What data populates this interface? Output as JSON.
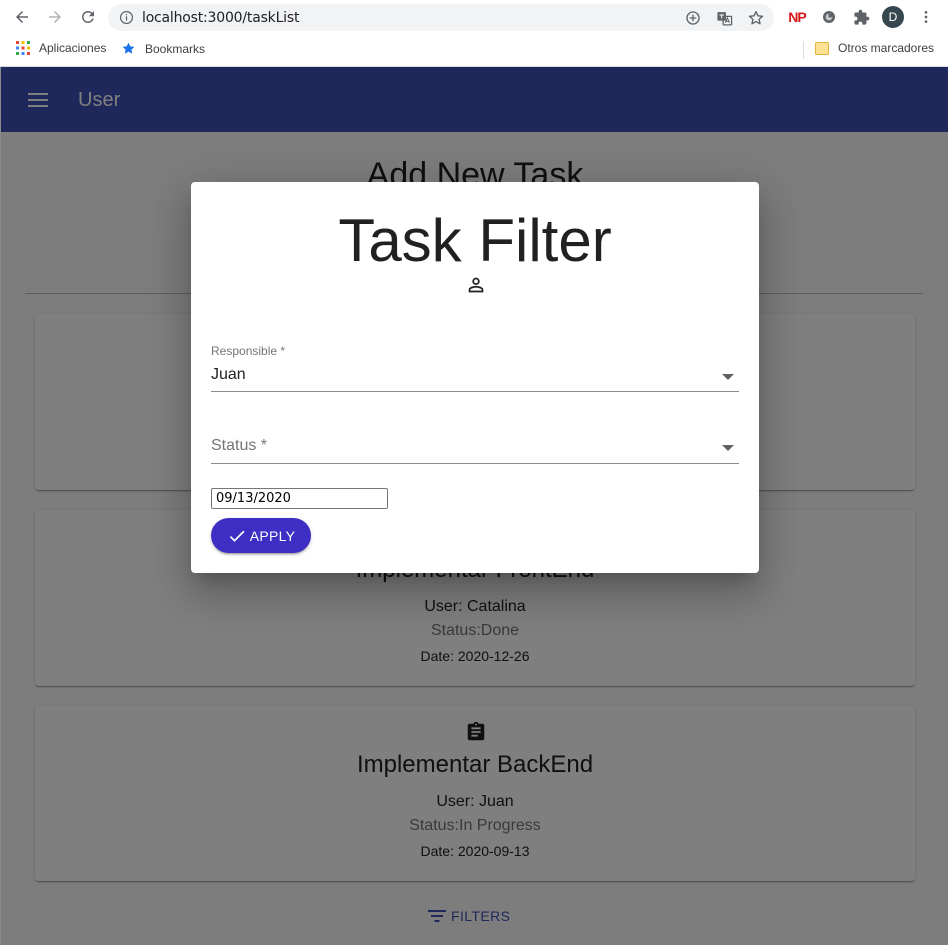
{
  "browser": {
    "url": "localhost:3000/taskList",
    "bookmarks": [
      {
        "label": "Aplicaciones"
      },
      {
        "label": "Bookmarks"
      }
    ],
    "other_bookmarks": "Otros marcadores",
    "extension_np": "NP",
    "avatar_letter": "D"
  },
  "appbar": {
    "title": "User"
  },
  "page": {
    "heading": "Add New Task",
    "filters_label": "FILTERS"
  },
  "cards": [
    {
      "title": "",
      "user": "",
      "status": "",
      "date": ""
    },
    {
      "title": "Implementar FrontEnd",
      "user": "User: Catalina",
      "status": "Status:Done",
      "date": "Date: 2020-12-26"
    },
    {
      "title": "Implementar BackEnd",
      "user": "User: Juan",
      "status": "Status:In Progress",
      "date": "Date: 2020-09-13"
    }
  ],
  "dialog": {
    "title": "Task Filter",
    "responsible_label": "Responsible *",
    "responsible_value": "Juan",
    "status_label": "Status *",
    "date_value": "09/13/2020",
    "apply_label": "APPLY"
  },
  "colors": {
    "appbar": "#3f51b5",
    "apply_button": "#3f2ec4"
  }
}
